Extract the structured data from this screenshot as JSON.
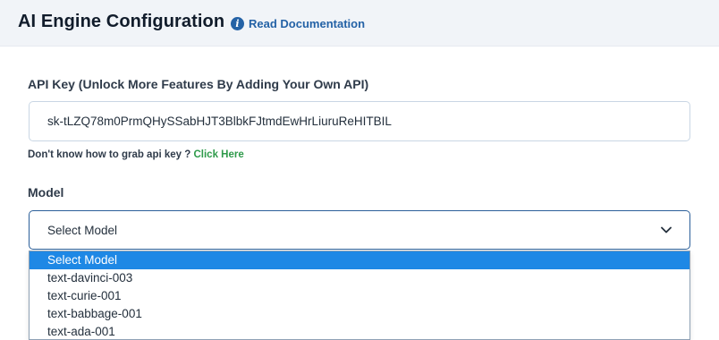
{
  "header": {
    "title": "AI Engine Configuration",
    "doc_icon": "info-icon",
    "doc_link": "Read Documentation"
  },
  "api_key": {
    "label": "API Key (Unlock More Features By Adding Your Own API)",
    "value": "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",
    "help_text": "Don't know how to grab api key ?",
    "help_link": "Click Here"
  },
  "model": {
    "label": "Model",
    "selected": "Select Model",
    "options": [
      "Select Model",
      "text-davinci-003",
      "text-curie-001",
      "text-babbage-001",
      "text-ada-001"
    ],
    "highlighted_index": 0
  },
  "colors": {
    "header_bg": "#f1f4f8",
    "link_blue": "#2462a6",
    "link_green": "#2e9a4a",
    "selected_option_bg": "#1e88e5",
    "focus_border": "#2b5f99"
  }
}
